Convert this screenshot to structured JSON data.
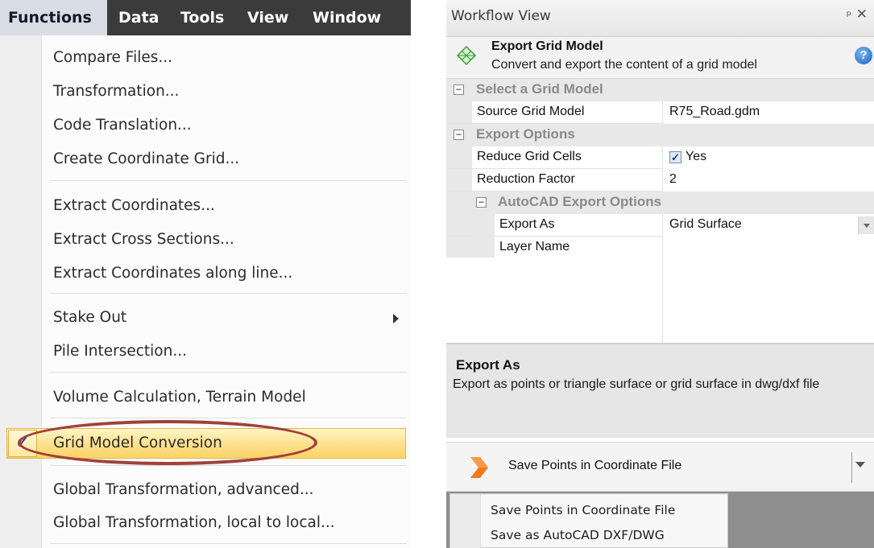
{
  "menubar": {
    "items": [
      {
        "label": "Functions",
        "active": true
      },
      {
        "label": "Data"
      },
      {
        "label": "Tools"
      },
      {
        "label": "View"
      },
      {
        "label": "Window"
      }
    ]
  },
  "functions_menu": {
    "items": [
      {
        "label": "Compare Files..."
      },
      {
        "label": "Transformation..."
      },
      {
        "label": "Code Translation..."
      },
      {
        "label": "Create Coordinate Grid..."
      },
      {
        "label": "Extract Coordinates..."
      },
      {
        "label": "Extract Cross Sections..."
      },
      {
        "label": "Extract Coordinates along line..."
      },
      {
        "label": "Stake Out",
        "has_submenu": true
      },
      {
        "label": "Pile Intersection..."
      },
      {
        "label": "Volume Calculation, Terrain Model"
      },
      {
        "label": "Grid Model Conversion",
        "checked": true,
        "highlighted": true
      },
      {
        "label": "Global Transformation, advanced..."
      },
      {
        "label": "Global Transformation, local to local..."
      }
    ],
    "check_glyph": "✓"
  },
  "workflow": {
    "title": "Workflow View",
    "pin_glyph": "ᵖ",
    "close_glyph": "✕",
    "header": {
      "icon": "grid-model-icon",
      "title": "Export Grid Model",
      "subtitle": "Convert and export the content of a grid model",
      "help_glyph": "?"
    },
    "properties": {
      "cat_select": {
        "toggle": "−",
        "label": "Select a Grid Model"
      },
      "source_model": {
        "name": "Source Grid Model",
        "value": "R75_Road.gdm"
      },
      "cat_export": {
        "toggle": "−",
        "label": "Export Options"
      },
      "reduce_cells": {
        "name": "Reduce Grid Cells",
        "value": "Yes",
        "checked": true,
        "check_glyph": "✓"
      },
      "reduction_factor": {
        "name": "Reduction Factor",
        "value": "2"
      },
      "cat_autocad": {
        "toggle": "−",
        "label": "AutoCAD Export Options"
      },
      "export_as": {
        "name": "Export As",
        "value": "Grid Surface"
      },
      "layer_name": {
        "name": "Layer Name",
        "value": ""
      }
    },
    "description": {
      "title": "Export As",
      "text": "Export as points or triangle surface or grid surface in dwg/dxf file"
    },
    "action": {
      "label": "Save Points in Coordinate File",
      "icon": "orange-arrow-icon"
    },
    "action_dropdown": {
      "items": [
        {
          "label": "Save Points in Coordinate File"
        },
        {
          "label": "Save as AutoCAD DXF/DWG"
        }
      ]
    }
  },
  "colors": {
    "menubar_bg": "#3b3b3b",
    "highlight": "#fde08a",
    "highlight_ring": "#a0413a",
    "action_arrow": "#f07a1a"
  }
}
